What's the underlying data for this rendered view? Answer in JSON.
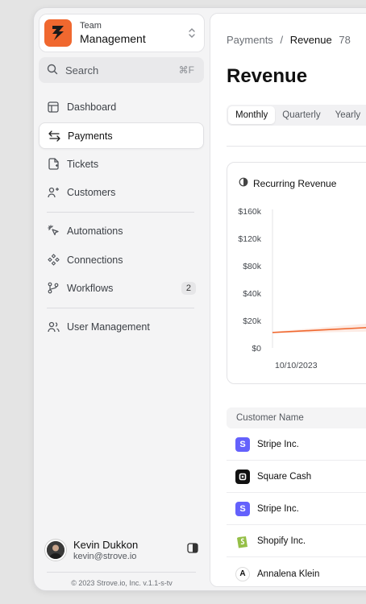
{
  "team": {
    "label": "Team",
    "name": "Management"
  },
  "search": {
    "label": "Search",
    "shortcut": "⌘F"
  },
  "nav": {
    "primary": [
      {
        "label": "Dashboard"
      },
      {
        "label": "Payments"
      },
      {
        "label": "Tickets"
      },
      {
        "label": "Customers"
      }
    ],
    "secondary": [
      {
        "label": "Automations"
      },
      {
        "label": "Connections"
      },
      {
        "label": "Workflows",
        "badge": "2"
      }
    ],
    "tertiary": [
      {
        "label": "User Management"
      }
    ]
  },
  "user": {
    "name": "Kevin Dukkon",
    "email": "kevin@strove.io"
  },
  "footer": {
    "copyright": "© 2023 Strove.io, Inc. v.1.1-s-tv"
  },
  "breadcrumb": {
    "parent": "Payments",
    "separator": "/",
    "current": "Revenue",
    "count": "78"
  },
  "page_title": "Revenue",
  "tabs": [
    {
      "label": "Monthly"
    },
    {
      "label": "Quarterly"
    },
    {
      "label": "Yearly"
    }
  ],
  "card": {
    "title": "Recurring Revenue"
  },
  "chart_data": {
    "type": "line",
    "title": "Recurring Revenue",
    "yticks": [
      "$160k",
      "$120k",
      "$80k",
      "$40k",
      "$20k",
      "$0"
    ],
    "xticks": [
      "10/10/2023"
    ],
    "series": [
      {
        "values": [
          18,
          21,
          24,
          28
        ]
      }
    ],
    "ylim": [
      0,
      160
    ],
    "color": "#f0682f"
  },
  "table": {
    "header": "Customer Name",
    "rows": [
      {
        "name": "Stripe Inc.",
        "logo": "S",
        "logo_color": "#6461fc"
      },
      {
        "name": "Square Cash",
        "logo": "",
        "logo_color": "#111111"
      },
      {
        "name": "Stripe Inc.",
        "logo": "S",
        "logo_color": "#6461fc"
      },
      {
        "name": "Shopify Inc.",
        "logo": "",
        "logo_color": "#95bf47"
      },
      {
        "name": "Annalena Klein",
        "logo": "A",
        "logo_color": "#ffffff"
      }
    ]
  }
}
